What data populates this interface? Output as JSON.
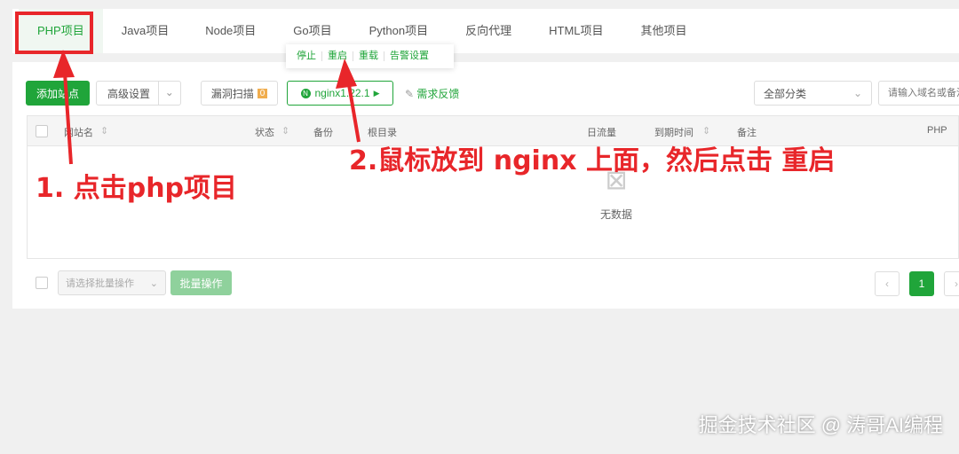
{
  "tabs": [
    "PHP项目",
    "Java项目",
    "Node项目",
    "Go项目",
    "Python项目",
    "反向代理",
    "HTML项目",
    "其他项目"
  ],
  "popup": [
    "停止",
    "重启",
    "重载",
    "告警设置"
  ],
  "toolbar": {
    "add_site": "添加站点",
    "advanced": "高级设置",
    "scan": "漏洞扫描",
    "scan_count": "0",
    "nginx": "nginx1.22.1",
    "feedback": "需求反馈",
    "category": "全部分类",
    "search_placeholder": "请输入域名或备注"
  },
  "columns": {
    "name": "网站名",
    "status": "状态",
    "backup": "备份",
    "root": "根目录",
    "traffic": "日流量",
    "expire": "到期时间",
    "remark": "备注",
    "php": "PHP"
  },
  "empty": "无数据",
  "footer": {
    "batch_select": "请选择批量操作",
    "batch_button": "批量操作",
    "page": "1"
  },
  "annotations": {
    "step1": "1. 点击php项目",
    "step2": "2.鼠标放到 nginx 上面，然后点击 重启"
  },
  "watermark": "掘金技术社区 @ 涛哥AI编程",
  "colors": {
    "accent": "#20a53a",
    "annotation": "#e8262a"
  }
}
